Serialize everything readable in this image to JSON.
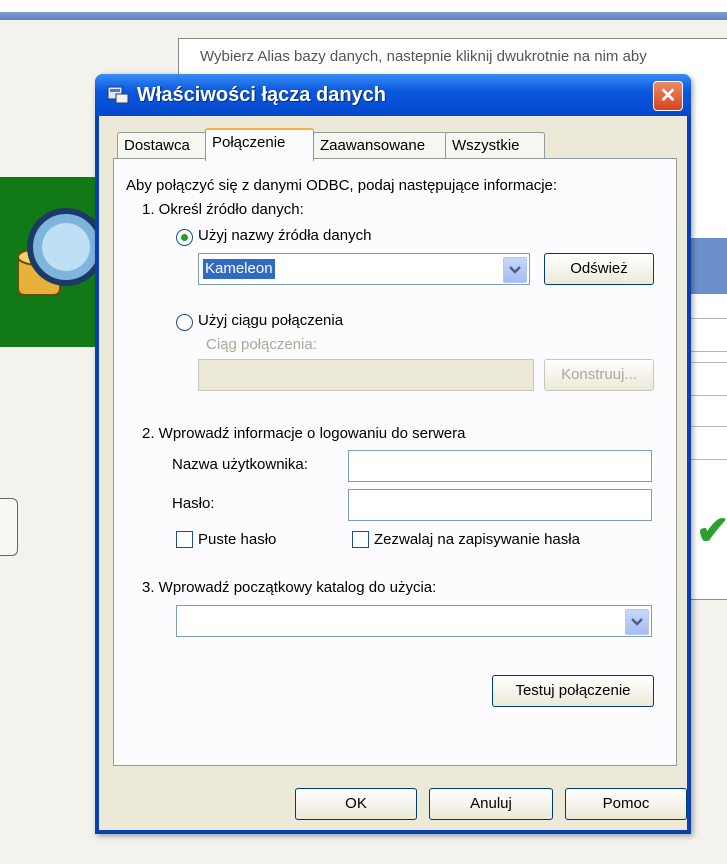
{
  "background": {
    "hint_text": "Wybierz Alias bazy danych, nastepnie kliknij dwukrotnie na nim aby"
  },
  "dialog": {
    "title": "Właściwości łącza danych",
    "close_label": "✕",
    "tabs": [
      {
        "label": "Dostawca"
      },
      {
        "label": "Połączenie"
      },
      {
        "label": "Zaawansowane"
      },
      {
        "label": "Wszystkie"
      }
    ],
    "active_tab": "Połączenie",
    "intro": "Aby połączyć się z danymi ODBC, podaj następujące informacje:",
    "step1": {
      "label": "1. Określ źródło danych:",
      "radio_dsn_label": "Użyj nazwy źródła danych",
      "dsn_value": "Kameleon",
      "refresh_label": "Odśwież",
      "radio_conn_label": "Użyj ciągu połączenia",
      "conn_string_label": "Ciąg połączenia:",
      "conn_string_value": "",
      "build_label": "Konstruuj..."
    },
    "step2": {
      "label": "2. Wprowadź informacje o logowaniu do serwera",
      "username_label": "Nazwa użytkownika:",
      "username_value": "",
      "password_label": "Hasło:",
      "password_value": "",
      "blank_password_label": "Puste hasło",
      "allow_saving_label": "Zezwalaj na zapisywanie hasła"
    },
    "step3": {
      "label": "3. Wprowadź początkowy katalog do użycia:",
      "catalog_value": ""
    },
    "test_button_label": "Testuj połączenie",
    "buttons": {
      "ok": "OK",
      "cancel": "Anuluj",
      "help": "Pomoc"
    }
  },
  "colors": {
    "title_bar": "#0548cc",
    "selection": "#316ac5",
    "radio_dot": "#21a121"
  }
}
